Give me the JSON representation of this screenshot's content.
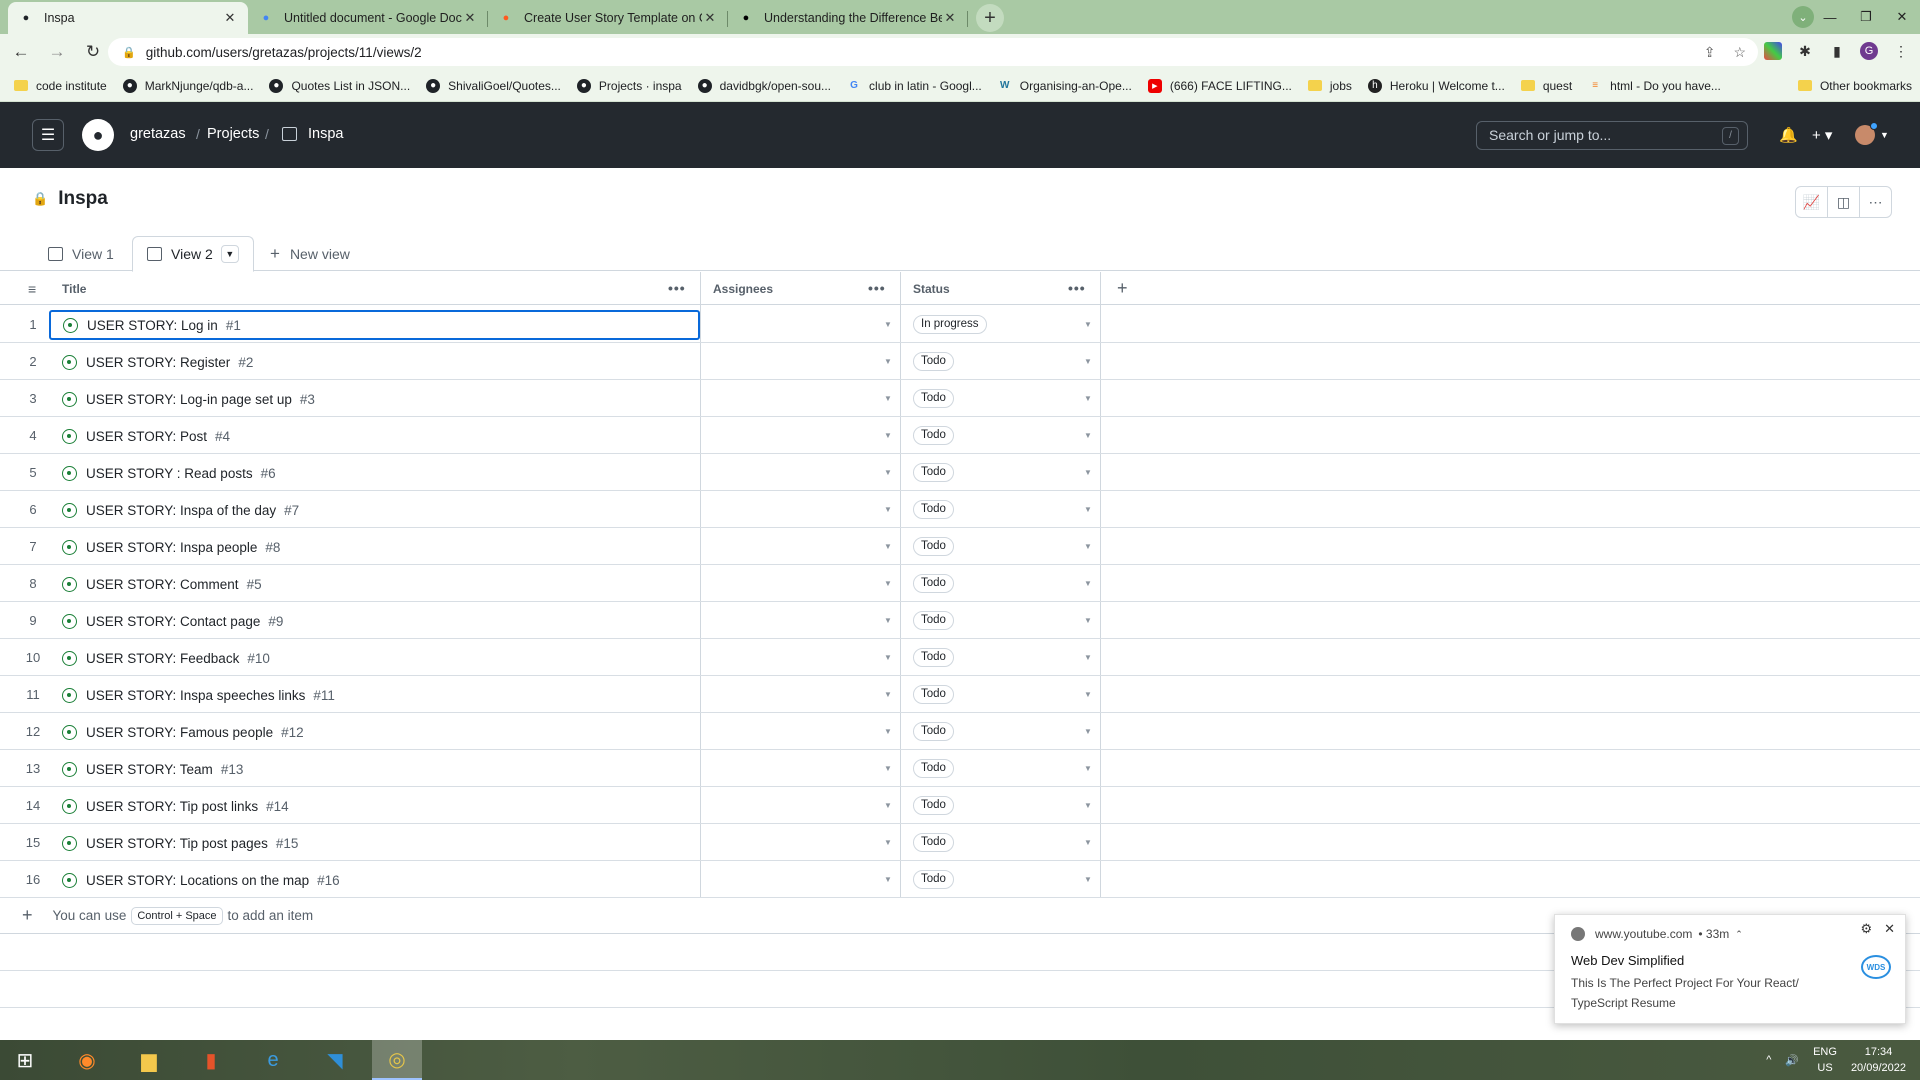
{
  "browser": {
    "tabs": [
      {
        "title": "Inspa",
        "icon": "github-icon",
        "active": true
      },
      {
        "title": "Untitled document - Google Doc",
        "icon": "docs-icon",
        "active": false
      },
      {
        "title": "Create User Story Template on G",
        "icon": "orange-ring-icon",
        "active": false
      },
      {
        "title": "Understanding the Difference Be",
        "icon": "wix-icon",
        "active": false
      }
    ],
    "url": "github.com/users/gretazas/projects/11/views/2",
    "bookmarks": [
      {
        "label": "code institute",
        "icon": "folder"
      },
      {
        "label": "MarkNjunge/qdb-a...",
        "icon": "github"
      },
      {
        "label": "Quotes List in JSON...",
        "icon": "github"
      },
      {
        "label": "ShivaliGoel/Quotes...",
        "icon": "github"
      },
      {
        "label": "Projects · inspa",
        "icon": "github"
      },
      {
        "label": "davidbgk/open-sou...",
        "icon": "github"
      },
      {
        "label": "club in latin - Googl...",
        "icon": "google"
      },
      {
        "label": "Organising-an-Ope...",
        "icon": "wordpress"
      },
      {
        "label": "(666) FACE LIFTING...",
        "icon": "youtube"
      },
      {
        "label": "jobs",
        "icon": "folder"
      },
      {
        "label": "Heroku | Welcome t...",
        "icon": "heroku"
      },
      {
        "label": "quest",
        "icon": "folder"
      },
      {
        "label": "html - Do you have...",
        "icon": "stackoverflow"
      }
    ],
    "more_bookmarks": "»",
    "other_bookmarks": "Other bookmarks",
    "profile_letter": "G"
  },
  "github": {
    "user": "gretazas",
    "projects": "Projects",
    "project": "Inspa",
    "search_placeholder": "Search or jump to...",
    "search_key": "/"
  },
  "project": {
    "title": "Inspa",
    "views": [
      {
        "label": "View 1",
        "active": false
      },
      {
        "label": "View 2",
        "active": true
      }
    ],
    "new_view": "New view",
    "columns": {
      "title": "Title",
      "assignees": "Assignees",
      "status": "Status"
    },
    "rows": [
      {
        "n": "1",
        "title": "USER STORY: Log in",
        "issue": "#1",
        "status": "In progress"
      },
      {
        "n": "2",
        "title": "USER STORY: Register",
        "issue": "#2",
        "status": "Todo"
      },
      {
        "n": "3",
        "title": "USER STORY: Log-in page set up",
        "issue": "#3",
        "status": "Todo"
      },
      {
        "n": "4",
        "title": "USER STORY: Post",
        "issue": "#4",
        "status": "Todo"
      },
      {
        "n": "5",
        "title": "USER STORY : Read posts",
        "issue": "#6",
        "status": "Todo"
      },
      {
        "n": "6",
        "title": "USER STORY: Inspa of the day",
        "issue": "#7",
        "status": "Todo"
      },
      {
        "n": "7",
        "title": "USER STORY: Inspa people",
        "issue": "#8",
        "status": "Todo"
      },
      {
        "n": "8",
        "title": "USER STORY: Comment",
        "issue": "#5",
        "status": "Todo"
      },
      {
        "n": "9",
        "title": "USER STORY: Contact page",
        "issue": "#9",
        "status": "Todo"
      },
      {
        "n": "10",
        "title": "USER STORY: Feedback",
        "issue": "#10",
        "status": "Todo"
      },
      {
        "n": "11",
        "title": "USER STORY: Inspa speeches links",
        "issue": "#11",
        "status": "Todo"
      },
      {
        "n": "12",
        "title": "USER STORY: Famous people",
        "issue": "#12",
        "status": "Todo"
      },
      {
        "n": "13",
        "title": "USER STORY: Team",
        "issue": "#13",
        "status": "Todo"
      },
      {
        "n": "14",
        "title": "USER STORY: Tip post links",
        "issue": "#14",
        "status": "Todo"
      },
      {
        "n": "15",
        "title": "USER STORY: Tip post pages",
        "issue": "#15",
        "status": "Todo"
      },
      {
        "n": "16",
        "title": "USER STORY: Locations on the map",
        "issue": "#16",
        "status": "Todo"
      }
    ],
    "add_hint_pre": "You can use",
    "add_hint_kbd": "Control + Space",
    "add_hint_post": "to add an item"
  },
  "notification": {
    "source": "www.youtube.com",
    "age": "• 33m",
    "title": "Web Dev Simplified",
    "body": "This Is The Perfect Project For Your React/ TypeScript Resume",
    "badge": "WDS"
  },
  "taskbar": {
    "lang": "ENG",
    "region": "US",
    "time": "17:34",
    "date": "20/09/2022"
  }
}
